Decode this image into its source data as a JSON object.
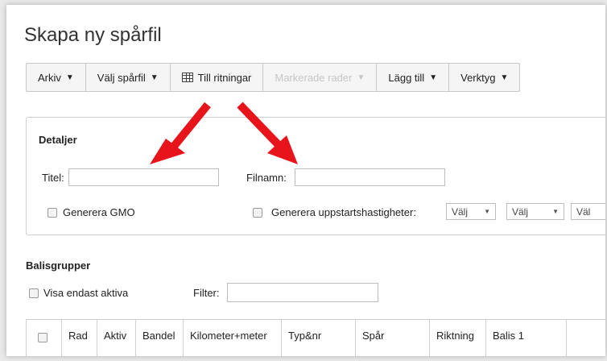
{
  "page": {
    "title": "Skapa ny spårfil"
  },
  "toolbar": {
    "arkiv": "Arkiv",
    "valj_sparfil": "Välj spårfil",
    "till_ritningar": "Till ritningar",
    "markerade_rader": "Markerade rader",
    "lagg_till": "Lägg till",
    "verktyg": "Verktyg"
  },
  "details": {
    "heading": "Detaljer",
    "titel_label": "Titel:",
    "titel_value": "",
    "filnamn_label": "Filnamn:",
    "filnamn_value": "",
    "generera_gmo": "Generera GMO",
    "generera_uppstart": "Generera uppstartshastigheter:",
    "selects": [
      "Välj",
      "Välj",
      "Väl"
    ]
  },
  "balisgrupper": {
    "heading": "Balisgrupper",
    "visa_aktiva": "Visa endast aktiva",
    "filter_label": "Filter:",
    "filter_value": ""
  },
  "table": {
    "columns": [
      "Rad",
      "Aktiv",
      "Bandel",
      "Kilometer+meter",
      "Typ&nr",
      "Spår",
      "Riktning",
      "Balis 1"
    ]
  },
  "colors": {
    "annotation_arrow": "#e8141b"
  },
  "icons": [
    "caret-down-icon",
    "table-grid-icon",
    "red-arrow-annotation"
  ]
}
